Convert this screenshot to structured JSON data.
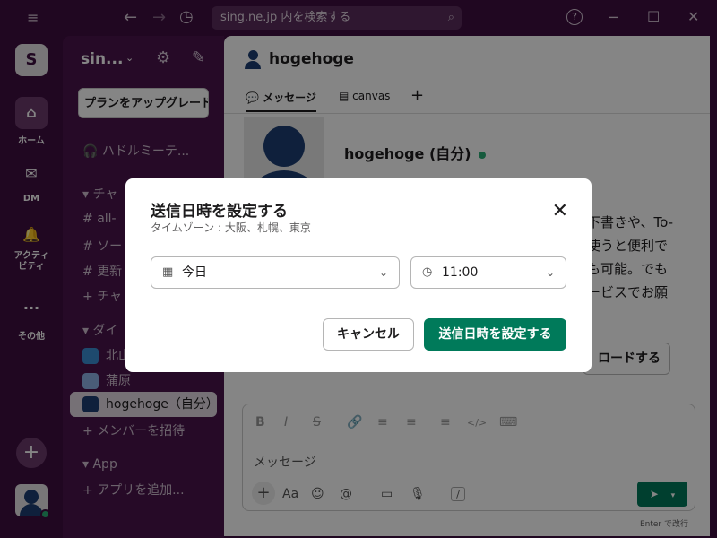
{
  "titlebar": {
    "menu_icon": "≡",
    "back_icon": "←",
    "forward_icon": "→",
    "history_icon": "◷",
    "search_placeholder": "sing.ne.jp 内を検索する",
    "help_icon": "?",
    "minimize_icon": "─",
    "maximize_icon": "☐",
    "close_icon": "✕"
  },
  "rail": {
    "workspace_initial": "S",
    "items": [
      {
        "label": "ホーム",
        "icon": "⌂"
      },
      {
        "label": "DM",
        "icon": "✉"
      },
      {
        "label": "アクティビティ",
        "icon": "🔔"
      },
      {
        "label": "その他",
        "icon": "···"
      }
    ],
    "add_icon": "+"
  },
  "sidebar": {
    "workspace_name": "sin...",
    "upgrade_label": "プランをアップグレード",
    "rows": [
      {
        "label": "ハドルミーテ...",
        "prefix": "🎧"
      },
      {
        "label": "チャ",
        "prefix": "▾"
      },
      {
        "label": "all-",
        "prefix": "#"
      },
      {
        "label": "ソー",
        "prefix": "#"
      },
      {
        "label": "更新",
        "prefix": "#"
      },
      {
        "label": "チャ",
        "prefix": "+"
      },
      {
        "label": "ダイ",
        "prefix": "▾"
      },
      {
        "label": "北山",
        "prefix": ""
      },
      {
        "label": "蒲原",
        "prefix": ""
      },
      {
        "label": "hogehoge（自分）",
        "prefix": ""
      },
      {
        "label": "メンバーを招待",
        "prefix": "+"
      },
      {
        "label": "App",
        "prefix": "▾"
      },
      {
        "label": "アプリを追加...",
        "prefix": "+"
      }
    ]
  },
  "main": {
    "channel_name": "hogehoge",
    "tabs": [
      {
        "label": "メッセージ",
        "icon": "💬"
      },
      {
        "label": "canvas",
        "icon": "▤"
      },
      {
        "label": "+",
        "icon": ""
      }
    ],
    "intro_name": "hogehoge (自分)",
    "body_lines": [
      "下書きや、To-",
      "使うと便利で",
      "も可能。でも",
      "ービスでお願"
    ],
    "upload_label": "ロードする",
    "composer_placeholder": "メッセージ",
    "format_icons": [
      "B",
      "I",
      "S",
      "🔗",
      "≡",
      "≡",
      "≡",
      "</>",
      "⌨"
    ],
    "action_icons": [
      "+",
      "Aa",
      "☺",
      "@",
      "▭",
      "🎙",
      "/"
    ],
    "send_icon": "➤",
    "hint": "Enter で改行"
  },
  "modal": {
    "title": "送信日時を設定する",
    "subtitle": "タイムゾーン : 大阪、札幌、東京",
    "date_value": "今日",
    "time_value": "11:00",
    "cancel_label": "キャンセル",
    "confirm_label": "送信日時を設定する"
  },
  "colors": {
    "sidebar_bg": "#4a154b",
    "rail_bg": "#3f0e40",
    "accent": "#007a5a",
    "online": "#2bac76"
  }
}
